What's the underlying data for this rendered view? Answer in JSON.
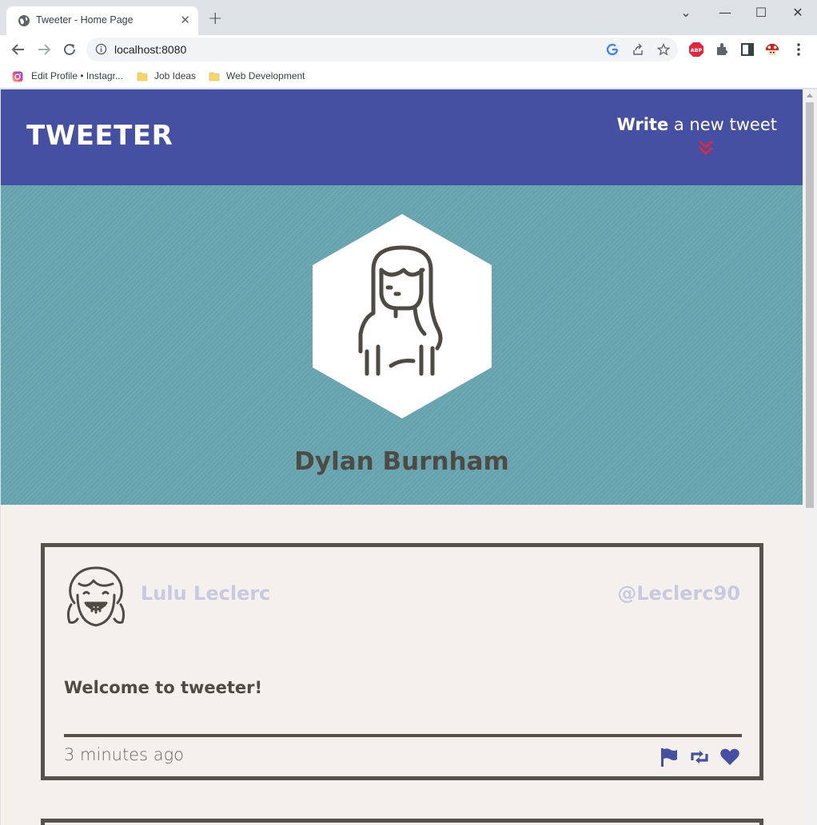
{
  "browser": {
    "tab_title": "Tweeter - Home Page",
    "tab_close": "✕",
    "new_tab": "+",
    "url": "localhost:8080",
    "bookmarks": [
      {
        "label": "Edit Profile • Instagr..."
      },
      {
        "label": "Job Ideas"
      },
      {
        "label": "Web Development"
      }
    ],
    "window_controls": {
      "chevron": "⌄",
      "minimize": "—",
      "maximize": "☐",
      "close": "✕"
    }
  },
  "nav": {
    "brand": "TWEETER",
    "compose_bold": "Write",
    "compose_rest": " a new tweet",
    "compose_icon": "double-chevron-down-icon",
    "accent": "#e8243a"
  },
  "profile": {
    "name": "Dylan Burnham"
  },
  "tweets": [
    {
      "name": "Lulu Leclerc",
      "handle": "@Leclerc90",
      "content": "Welcome to tweeter!",
      "time": "3 minutes ago",
      "actions": [
        "flag-icon",
        "retweet-icon",
        "heart-icon"
      ]
    }
  ],
  "colors": {
    "nav_bg": "#4650a2",
    "hero_bg": "#67a6b1",
    "page_bg": "#f4f1ec",
    "text_dark": "#4e4b45",
    "muted_name": "#c8c9e0",
    "action_icon": "#4650a2"
  }
}
